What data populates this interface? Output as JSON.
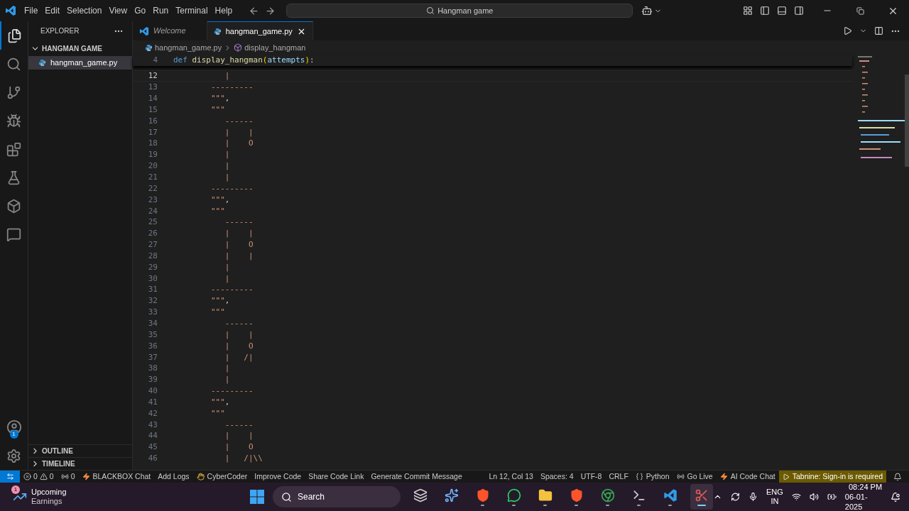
{
  "menu": [
    "File",
    "Edit",
    "Selection",
    "View",
    "Go",
    "Run",
    "Terminal",
    "Help"
  ],
  "command_center": "Hangman game",
  "sidebar": {
    "title": "EXPLORER",
    "folder": {
      "name": "HANGMAN GAME",
      "expanded": true,
      "children": [
        {
          "name": "hangman_game.py",
          "selected": true
        }
      ]
    },
    "sections": [
      {
        "label": "OUTLINE",
        "expanded": false
      },
      {
        "label": "TIMELINE",
        "expanded": false
      }
    ]
  },
  "account_badge": "1",
  "tabs": [
    {
      "label": "Welcome",
      "kind": "welcome",
      "selected": false
    },
    {
      "label": "hangman_game.py",
      "kind": "python",
      "selected": true
    }
  ],
  "breadcrumbs": [
    "hangman_game.py",
    "display_hangman"
  ],
  "sticky": {
    "number": "4",
    "tokens": [
      {
        "text": "def ",
        "kind": "keyword"
      },
      {
        "text": "display_hangman",
        "kind": "function"
      },
      {
        "text": "(",
        "kind": "paren"
      },
      {
        "text": "attempts",
        "kind": "param"
      },
      {
        "text": ")",
        "kind": "paren"
      },
      {
        "text": ":",
        "kind": "punct"
      }
    ]
  },
  "lines": [
    {
      "number": "12",
      "current": true,
      "tokens": [
        {
          "text": "           |",
          "kind": "string"
        }
      ]
    },
    {
      "number": "13",
      "current": false,
      "tokens": [
        {
          "text": "        ---------",
          "kind": "string"
        }
      ]
    },
    {
      "number": "14",
      "current": false,
      "tokens": [
        {
          "text": "        \"\"\"",
          "kind": "string"
        },
        {
          "text": ",",
          "kind": "punct"
        }
      ]
    },
    {
      "number": "15",
      "current": false,
      "tokens": [
        {
          "text": "        \"\"\"",
          "kind": "string"
        }
      ]
    },
    {
      "number": "16",
      "current": false,
      "tokens": [
        {
          "text": "           ------",
          "kind": "string"
        }
      ]
    },
    {
      "number": "17",
      "current": false,
      "tokens": [
        {
          "text": "           |    |",
          "kind": "string"
        }
      ]
    },
    {
      "number": "18",
      "current": false,
      "tokens": [
        {
          "text": "           |    O",
          "kind": "string"
        }
      ]
    },
    {
      "number": "19",
      "current": false,
      "tokens": [
        {
          "text": "           |",
          "kind": "string"
        }
      ]
    },
    {
      "number": "20",
      "current": false,
      "tokens": [
        {
          "text": "           |",
          "kind": "string"
        }
      ]
    },
    {
      "number": "21",
      "current": false,
      "tokens": [
        {
          "text": "           |",
          "kind": "string"
        }
      ]
    },
    {
      "number": "22",
      "current": false,
      "tokens": [
        {
          "text": "        ---------",
          "kind": "string"
        }
      ]
    },
    {
      "number": "23",
      "current": false,
      "tokens": [
        {
          "text": "        \"\"\"",
          "kind": "string"
        },
        {
          "text": ",",
          "kind": "punct"
        }
      ]
    },
    {
      "number": "24",
      "current": false,
      "tokens": [
        {
          "text": "        \"\"\"",
          "kind": "string"
        }
      ]
    },
    {
      "number": "25",
      "current": false,
      "tokens": [
        {
          "text": "           ------",
          "kind": "string"
        }
      ]
    },
    {
      "number": "26",
      "current": false,
      "tokens": [
        {
          "text": "           |    |",
          "kind": "string"
        }
      ]
    },
    {
      "number": "27",
      "current": false,
      "tokens": [
        {
          "text": "           |    O",
          "kind": "string"
        }
      ]
    },
    {
      "number": "28",
      "current": false,
      "tokens": [
        {
          "text": "           |    |",
          "kind": "string"
        }
      ]
    },
    {
      "number": "29",
      "current": false,
      "tokens": [
        {
          "text": "           |",
          "kind": "string"
        }
      ]
    },
    {
      "number": "30",
      "current": false,
      "tokens": [
        {
          "text": "           |",
          "kind": "string"
        }
      ]
    },
    {
      "number": "31",
      "current": false,
      "tokens": [
        {
          "text": "        ---------",
          "kind": "string"
        }
      ]
    },
    {
      "number": "32",
      "current": false,
      "tokens": [
        {
          "text": "        \"\"\"",
          "kind": "string"
        },
        {
          "text": ",",
          "kind": "punct"
        }
      ]
    },
    {
      "number": "33",
      "current": false,
      "tokens": [
        {
          "text": "        \"\"\"",
          "kind": "string"
        }
      ]
    },
    {
      "number": "34",
      "current": false,
      "tokens": [
        {
          "text": "           ------",
          "kind": "string"
        }
      ]
    },
    {
      "number": "35",
      "current": false,
      "tokens": [
        {
          "text": "           |    |",
          "kind": "string"
        }
      ]
    },
    {
      "number": "36",
      "current": false,
      "tokens": [
        {
          "text": "           |    O",
          "kind": "string"
        }
      ]
    },
    {
      "number": "37",
      "current": false,
      "tokens": [
        {
          "text": "           |   /|",
          "kind": "string"
        }
      ]
    },
    {
      "number": "38",
      "current": false,
      "tokens": [
        {
          "text": "           |",
          "kind": "string"
        }
      ]
    },
    {
      "number": "39",
      "current": false,
      "tokens": [
        {
          "text": "           |",
          "kind": "string"
        }
      ]
    },
    {
      "number": "40",
      "current": false,
      "tokens": [
        {
          "text": "        ---------",
          "kind": "string"
        }
      ]
    },
    {
      "number": "41",
      "current": false,
      "tokens": [
        {
          "text": "        \"\"\"",
          "kind": "string"
        },
        {
          "text": ",",
          "kind": "punct"
        }
      ]
    },
    {
      "number": "42",
      "current": false,
      "tokens": [
        {
          "text": "        \"\"\"",
          "kind": "string"
        }
      ]
    },
    {
      "number": "43",
      "current": false,
      "tokens": [
        {
          "text": "           ------",
          "kind": "string"
        }
      ]
    },
    {
      "number": "44",
      "current": false,
      "tokens": [
        {
          "text": "           |    |",
          "kind": "string"
        }
      ]
    },
    {
      "number": "45",
      "current": false,
      "tokens": [
        {
          "text": "           |    O",
          "kind": "string"
        }
      ]
    },
    {
      "number": "46",
      "current": false,
      "tokens": [
        {
          "text": "           |   /|\\\\",
          "kind": "string"
        }
      ]
    }
  ],
  "status_left": [
    {
      "kind": "problems",
      "errors": "0",
      "warnings": "0"
    },
    {
      "kind": "ports",
      "text": "0"
    },
    {
      "kind": "bolt",
      "text": "BLACKBOX Chat"
    },
    {
      "kind": "plain",
      "text": "Add Logs"
    },
    {
      "kind": "hand",
      "text": "CyberCoder"
    },
    {
      "kind": "plain",
      "text": "Improve Code"
    },
    {
      "kind": "plain",
      "text": "Share Code Link"
    },
    {
      "kind": "plain",
      "text": "Generate Commit Message"
    }
  ],
  "status_right": [
    {
      "kind": "plain",
      "text": "Ln 12, Col 13"
    },
    {
      "kind": "plain",
      "text": "Spaces: 4"
    },
    {
      "kind": "plain",
      "text": "UTF-8"
    },
    {
      "kind": "plain",
      "text": "CRLF"
    },
    {
      "kind": "braces",
      "text": "Python"
    },
    {
      "kind": "broadcast",
      "text": "Go Live"
    },
    {
      "kind": "bolt",
      "text": "AI Code Chat"
    },
    {
      "kind": "warning",
      "text": "Tabnine: Sign-in is required"
    }
  ],
  "taskbar": {
    "widget": {
      "title": "Upcoming",
      "subtitle": "Earnings",
      "badge": "1"
    },
    "search": "Search",
    "apps": [
      {
        "kind": "taskview",
        "running": false,
        "selected": false
      },
      {
        "kind": "copilot",
        "running": false,
        "selected": false
      },
      {
        "kind": "lion",
        "running": true,
        "selected": false
      },
      {
        "kind": "chat",
        "running": true,
        "selected": false
      },
      {
        "kind": "folder",
        "running": true,
        "selected": false
      },
      {
        "kind": "lion",
        "running": true,
        "selected": false
      },
      {
        "kind": "chrome",
        "running": true,
        "selected": false
      },
      {
        "kind": "terminal",
        "running": true,
        "selected": false
      },
      {
        "kind": "vscode",
        "running": true,
        "selected": false
      },
      {
        "kind": "snip",
        "running": true,
        "selected": true
      }
    ],
    "language": [
      "ENG",
      "IN"
    ],
    "time": "08:24 PM",
    "date": "06-01-2025"
  }
}
